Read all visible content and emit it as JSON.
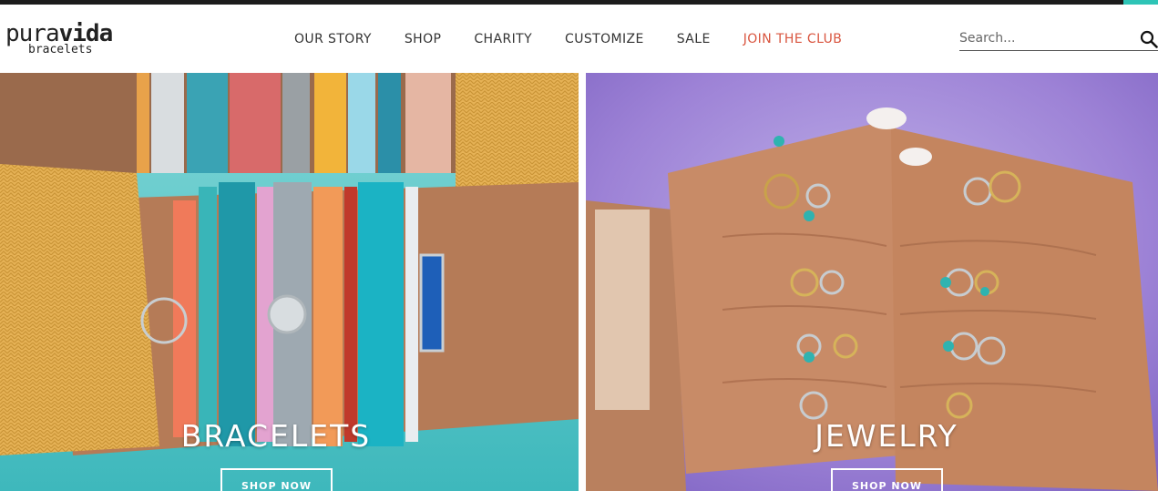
{
  "brand": {
    "name_light": "pura",
    "name_bold": "vida",
    "sub": "bracelets"
  },
  "nav": {
    "items": [
      {
        "label": "OUR STORY"
      },
      {
        "label": "SHOP"
      },
      {
        "label": "CHARITY"
      },
      {
        "label": "CUSTOMIZE"
      },
      {
        "label": "SALE"
      },
      {
        "label": "JOIN THE CLUB",
        "color": "#d9553f"
      }
    ]
  },
  "search": {
    "placeholder": "Search...",
    "icon": "search-icon"
  },
  "panels": [
    {
      "title": "BRACELETS",
      "button": "SHOP NOW"
    },
    {
      "title": "JEWELRY",
      "button": "SHOP NOW"
    }
  ],
  "colors": {
    "accent": "#2ec4b6",
    "club": "#d9553f",
    "topbar": "#1c1c1c"
  }
}
